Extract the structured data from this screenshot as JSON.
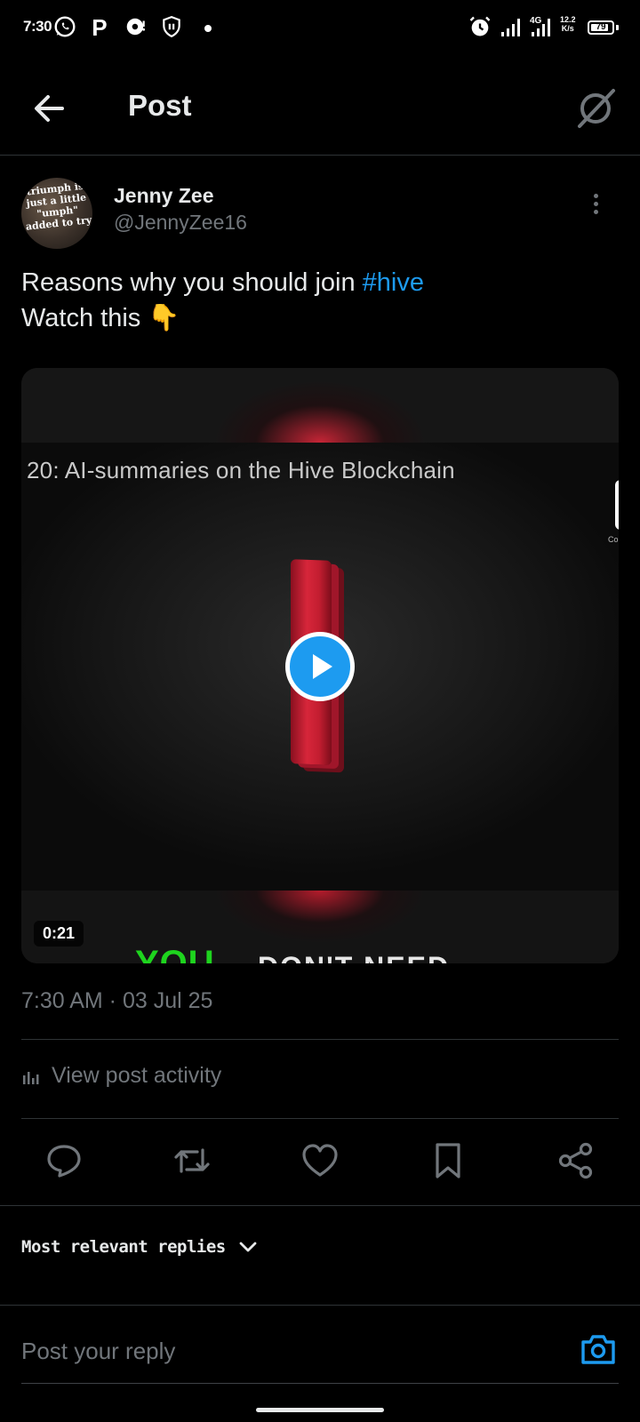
{
  "status_bar": {
    "time": "7:30",
    "network_speed_value": "12.2",
    "network_speed_unit": "K/s",
    "network_type": "4G",
    "battery": "79"
  },
  "header": {
    "title": "Post"
  },
  "post": {
    "author": {
      "name": "Jenny Zee",
      "handle": "@JennyZee16",
      "avatar_text": "triumph is just a little \"umph\" added to try"
    },
    "text_line1": "Reasons why you should join ",
    "hashtag": "#hive",
    "text_line2": "Watch this 👇",
    "video": {
      "caption": "20: AI-summaries on the Hive Blockchain",
      "duration": "0:21",
      "side_label": "Co",
      "overlay_green": "YOU",
      "overlay_white": "DON'T NEED"
    },
    "timestamp": "7:30 AM · 03 Jul 25",
    "activity_label": "View post activity"
  },
  "actions": [
    "reply-icon",
    "repost-icon",
    "like-icon",
    "bookmark-icon",
    "share-icon"
  ],
  "replies": {
    "sort_label": "Most relevant replies"
  },
  "reply_box": {
    "placeholder": "Post your reply"
  },
  "colors": {
    "background": "#000000",
    "accent": "#1d9bf0",
    "muted": "#71767b",
    "divider": "#2f3336"
  }
}
